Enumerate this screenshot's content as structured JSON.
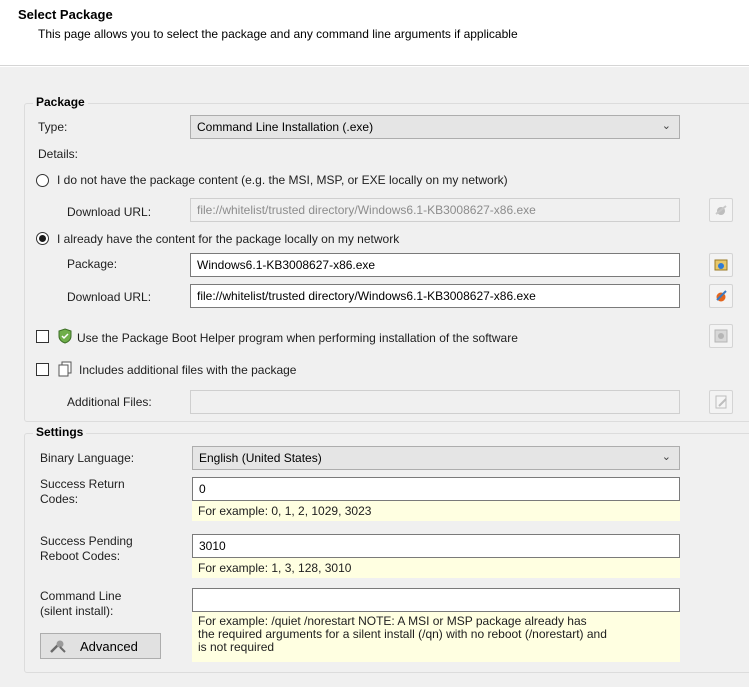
{
  "header": {
    "title": "Select Package",
    "subtitle": "This page allows you to select the package and any command line arguments if applicable"
  },
  "package_group": {
    "title": "Package",
    "type_label": "Type:",
    "type_value": "Command Line Installation (.exe)",
    "details_label": "Details:",
    "radio_no_content_label": "I do not have the package content (e.g. the MSI, MSP, or EXE locally on my network)",
    "download_url_label": "Download URL:",
    "download_url_disabled_value": "file://whitelist/trusted directory/Windows6.1-KB3008627-x86.exe",
    "radio_have_content_label": "I already have the content for the package locally on my network",
    "package_label": "Package:",
    "package_value": "Windows6.1-KB3008627-x86.exe",
    "download_url_value": "file://whitelist/trusted directory/Windows6.1-KB3008627-x86.exe",
    "boot_helper_label": "Use the Package Boot Helper program when performing installation of the software",
    "additional_files_check_label": "Includes additional files with the package",
    "additional_files_label": "Additional Files:",
    "additional_files_value": ""
  },
  "settings_group": {
    "title": "Settings",
    "binary_language_label": "Binary Language:",
    "binary_language_value": "English (United States)",
    "success_return_label_1": "Success Return",
    "success_return_label_2": "Codes:",
    "success_return_value": "0",
    "success_return_hint": "For example: 0, 1, 2, 1029, 3023",
    "pending_reboot_label_1": "Success Pending",
    "pending_reboot_label_2": "Reboot Codes:",
    "pending_reboot_value": "3010",
    "pending_reboot_hint": "For example: 1, 3, 128, 3010",
    "command_line_label_1": "Command Line",
    "command_line_label_2": "(silent install):",
    "command_line_value": "",
    "command_line_hint_1": "For example: /quiet /norestart  NOTE: A MSI or MSP package already has",
    "command_line_hint_2": "the required arguments for a silent install (/qn) with no reboot (/norestart) and",
    "command_line_hint_3": "is not required",
    "advanced_button": "Advanced"
  },
  "state": {
    "selected_radio": "have_content",
    "boot_helper_checked": false,
    "additional_files_checked": false
  }
}
